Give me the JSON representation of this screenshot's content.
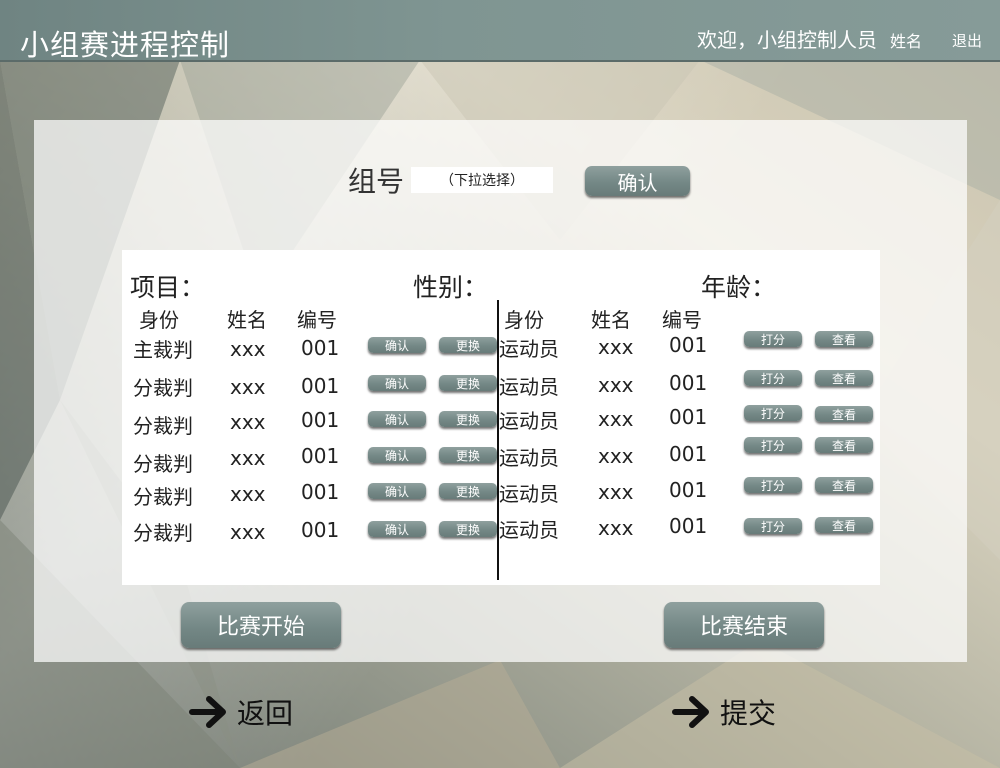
{
  "header": {
    "title": "小组赛进程控制",
    "welcome": "欢迎，小组控制人员",
    "user_name": "姓名",
    "logout": "退出"
  },
  "group": {
    "label": "组号",
    "select_value": "（下拉选择）",
    "confirm": "确认"
  },
  "fields": {
    "event": "项目：",
    "gender": "性别：",
    "age": "年龄："
  },
  "referees": {
    "headers": [
      "身份",
      "姓名",
      "编号"
    ],
    "rows": [
      {
        "role": "主裁判",
        "name": "xxx",
        "id": "001",
        "confirm": "确认",
        "replace": "更换"
      },
      {
        "role": "分裁判",
        "name": "xxx",
        "id": "001",
        "confirm": "确认",
        "replace": "更换"
      },
      {
        "role": "分裁判",
        "name": "xxx",
        "id": "001",
        "confirm": "确认",
        "replace": "更换"
      },
      {
        "role": "分裁判",
        "name": "xxx",
        "id": "001",
        "confirm": "确认",
        "replace": "更换"
      },
      {
        "role": "分裁判",
        "name": "xxx",
        "id": "001",
        "confirm": "确认",
        "replace": "更换"
      },
      {
        "role": "分裁判",
        "name": "xxx",
        "id": "001",
        "confirm": "确认",
        "replace": "更换"
      }
    ]
  },
  "athletes": {
    "headers": [
      "身份",
      "姓名",
      "编号"
    ],
    "rows": [
      {
        "role": "运动员",
        "name": "xxx",
        "id": "001",
        "score": "打分",
        "view": "查看"
      },
      {
        "role": "运动员",
        "name": "xxx",
        "id": "001",
        "score": "打分",
        "view": "查看"
      },
      {
        "role": "运动员",
        "name": "xxx",
        "id": "001",
        "score": "打分",
        "view": "查看"
      },
      {
        "role": "运动员",
        "name": "xxx",
        "id": "001",
        "score": "打分",
        "view": "查看"
      },
      {
        "role": "运动员",
        "name": "xxx",
        "id": "001",
        "score": "打分",
        "view": "查看"
      },
      {
        "role": "运动员",
        "name": "xxx",
        "id": "001",
        "score": "打分",
        "view": "查看"
      }
    ]
  },
  "actions": {
    "start": "比赛开始",
    "end": "比赛结束"
  },
  "nav": {
    "back": "返回",
    "submit": "提交",
    "arrow_icon": "arrow-right-icon"
  },
  "colors": {
    "header_bar": "#7f9592",
    "button": "#748886",
    "button_text": "#ffffff"
  }
}
